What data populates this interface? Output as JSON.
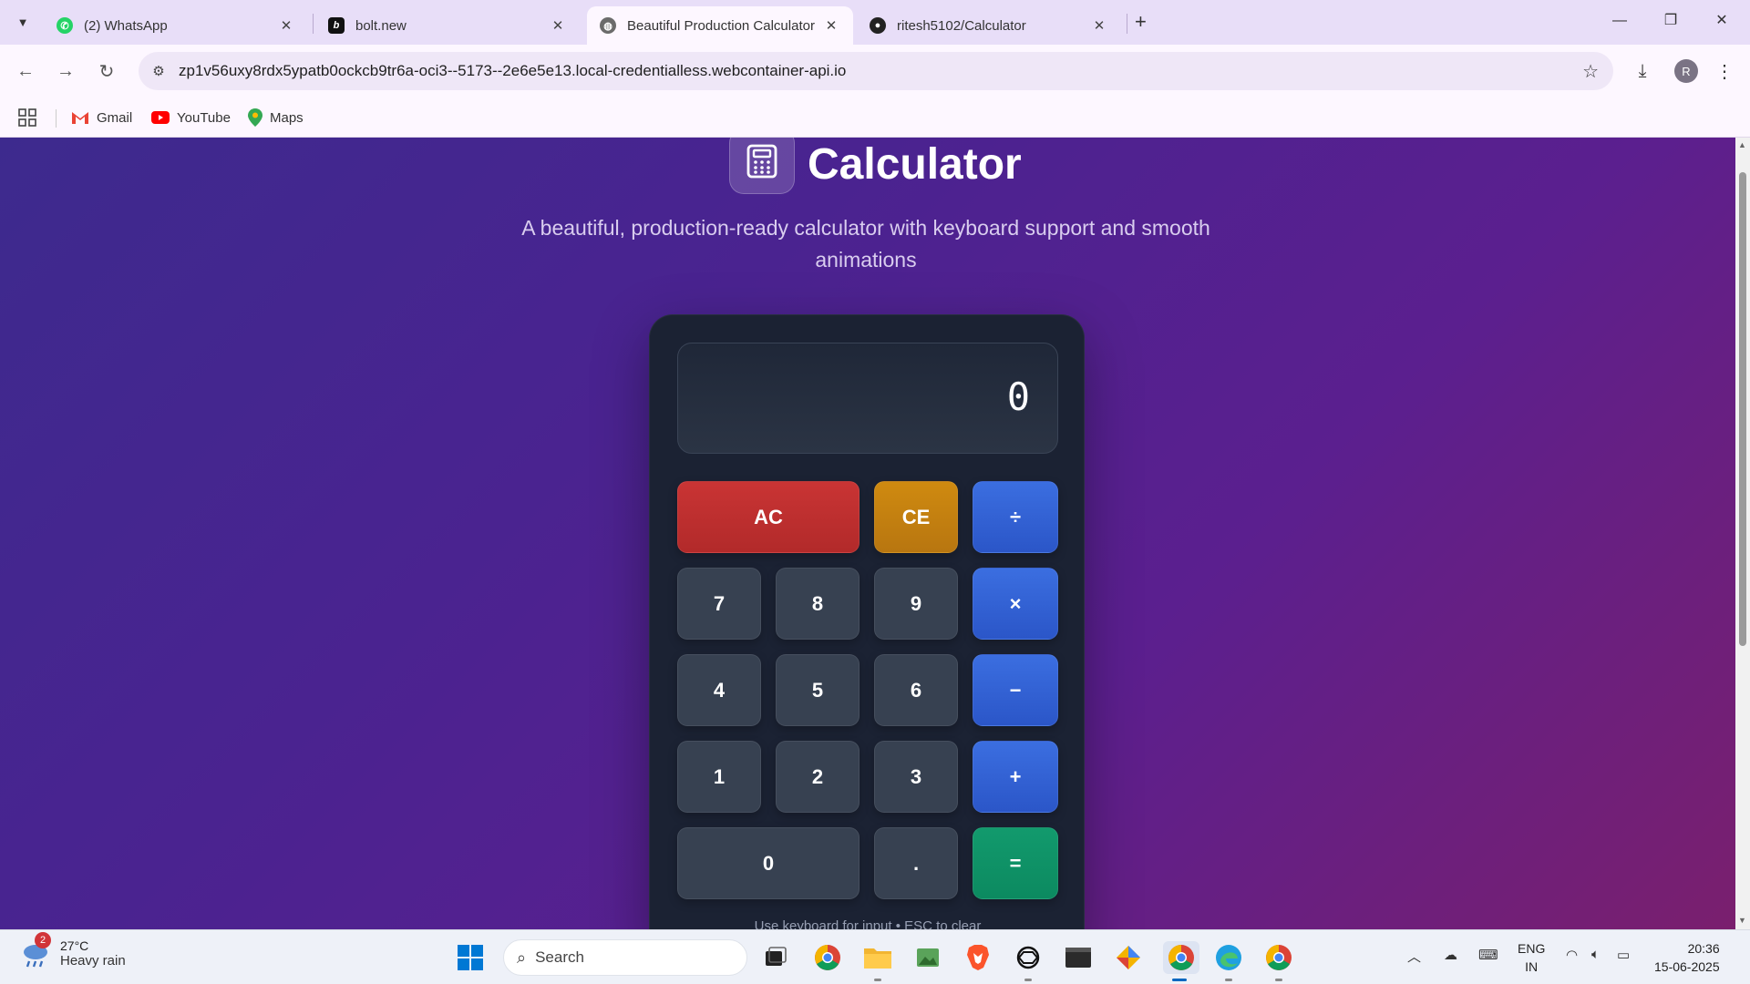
{
  "browser": {
    "tabs": [
      {
        "label": "(2) WhatsApp",
        "active": false
      },
      {
        "label": "bolt.new",
        "active": false
      },
      {
        "label": "Beautiful Production Calculator",
        "active": true
      },
      {
        "label": "ritesh5102/Calculator",
        "active": false
      }
    ],
    "url": "zp1v56uxy8rdx5ypatb0ockcb9tr6a-oci3--5173--2e6e5e13.local-credentialless.webcontainer-api.io",
    "profile_initial": "R",
    "bookmarks": [
      "Gmail",
      "YouTube",
      "Maps"
    ]
  },
  "page": {
    "title": "Calculator",
    "subtitle": "A beautiful, production-ready calculator with keyboard support and smooth animations",
    "display_value": "0",
    "hint": "Use keyboard for input • ESC to clear",
    "keys": {
      "ac": "AC",
      "ce": "CE",
      "divide": "÷",
      "multiply": "×",
      "subtract": "−",
      "add": "+",
      "equals": "=",
      "decimal": ".",
      "d7": "7",
      "d8": "8",
      "d9": "9",
      "d4": "4",
      "d5": "5",
      "d6": "6",
      "d1": "1",
      "d2": "2",
      "d3": "3",
      "d0": "0"
    }
  },
  "taskbar": {
    "weather_temp": "27°C",
    "weather_desc": "Heavy rain",
    "weather_badge": "2",
    "search_placeholder": "Search",
    "lang_top": "ENG",
    "lang_bottom": "IN",
    "time": "20:36",
    "date": "15-06-2025"
  },
  "colors": {
    "accent_operator": "#2b56c8",
    "clear": "#b22a2a",
    "clear_entry": "#b87610",
    "equals": "#0c8a60",
    "number_key": "#374151",
    "calculator_body": "#1b2233"
  }
}
